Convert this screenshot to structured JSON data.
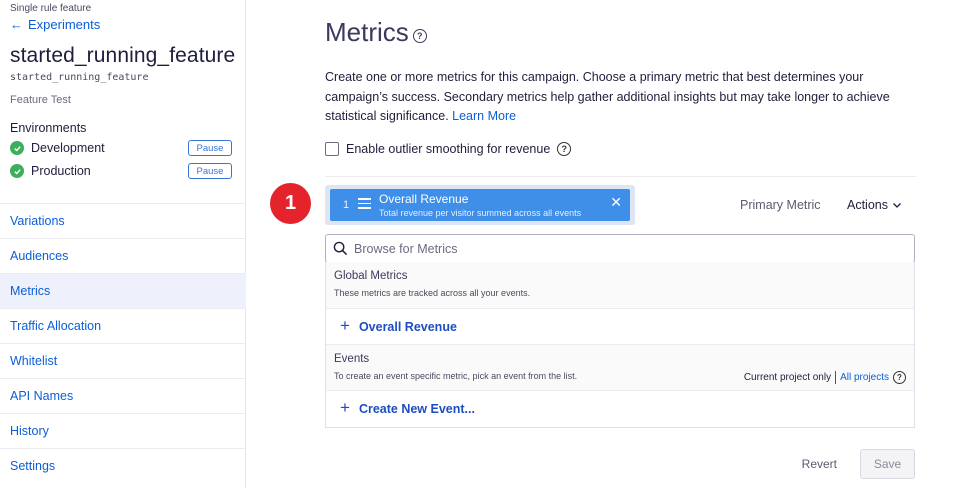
{
  "sidebar": {
    "feature_type": "Single rule feature",
    "back_label": "Experiments",
    "feature_title": "started_running_feature",
    "feature_key": "started_running_feature",
    "feature_kind": "Feature Test",
    "environments_heading": "Environments",
    "environments": [
      {
        "name": "Development",
        "status_color": "#3dae5b",
        "button": "Pause"
      },
      {
        "name": "Production",
        "status_color": "#3dae5b",
        "button": "Pause"
      }
    ],
    "nav": [
      {
        "label": "Variations",
        "active": false
      },
      {
        "label": "Audiences",
        "active": false
      },
      {
        "label": "Metrics",
        "active": true
      },
      {
        "label": "Traffic Allocation",
        "active": false
      },
      {
        "label": "Whitelist",
        "active": false
      },
      {
        "label": "API Names",
        "active": false
      },
      {
        "label": "History",
        "active": false
      },
      {
        "label": "Settings",
        "active": false
      }
    ]
  },
  "main": {
    "title": "Metrics",
    "description": "Create one or more metrics for this campaign. Choose a primary metric that best determines your campaign’s success. Secondary metrics help gather additional insights but may take longer to achieve statistical significance.",
    "learn_more": "Learn More",
    "outlier_label": "Enable outlier smoothing for revenue",
    "step_badge": "1",
    "selected_metric": {
      "index": "1",
      "name": "Overall Revenue",
      "description": "Total revenue per visitor summed across all events",
      "role": "Primary Metric"
    },
    "actions_label": "Actions",
    "search": {
      "placeholder": "Browse for Metrics"
    },
    "global_metrics": {
      "title": "Global Metrics",
      "subtitle": "These metrics are tracked across all your events.",
      "add_item": "Overall Revenue"
    },
    "events": {
      "title": "Events",
      "subtitle": "To create an event specific metric, pick an event from the list.",
      "scope_current": "Current project only",
      "scope_all": "All projects",
      "add_item": "Create New Event..."
    },
    "revert_label": "Revert",
    "save_label": "Save"
  },
  "colors": {
    "accent": "#0b5ed7",
    "chip": "#3f8ee8",
    "badge": "#e4232b",
    "success": "#3dae5b"
  }
}
